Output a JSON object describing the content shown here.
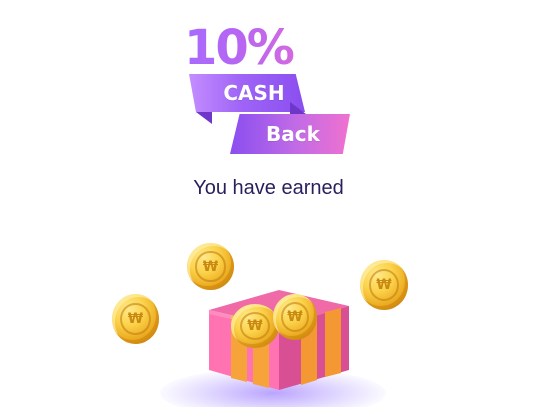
{
  "promo": {
    "percent": "10%",
    "ribbon_top": "CASH",
    "ribbon_bottom": "Back",
    "earned_label": "You have earned"
  },
  "icons": {
    "coin": "coin-icon",
    "gift": "gift-box-icon"
  },
  "colors": {
    "accent_purple": "#8a4ef0",
    "accent_pink": "#f071cf",
    "text_dark": "#2a1f5c",
    "coin_gold": "#fbd24a"
  }
}
